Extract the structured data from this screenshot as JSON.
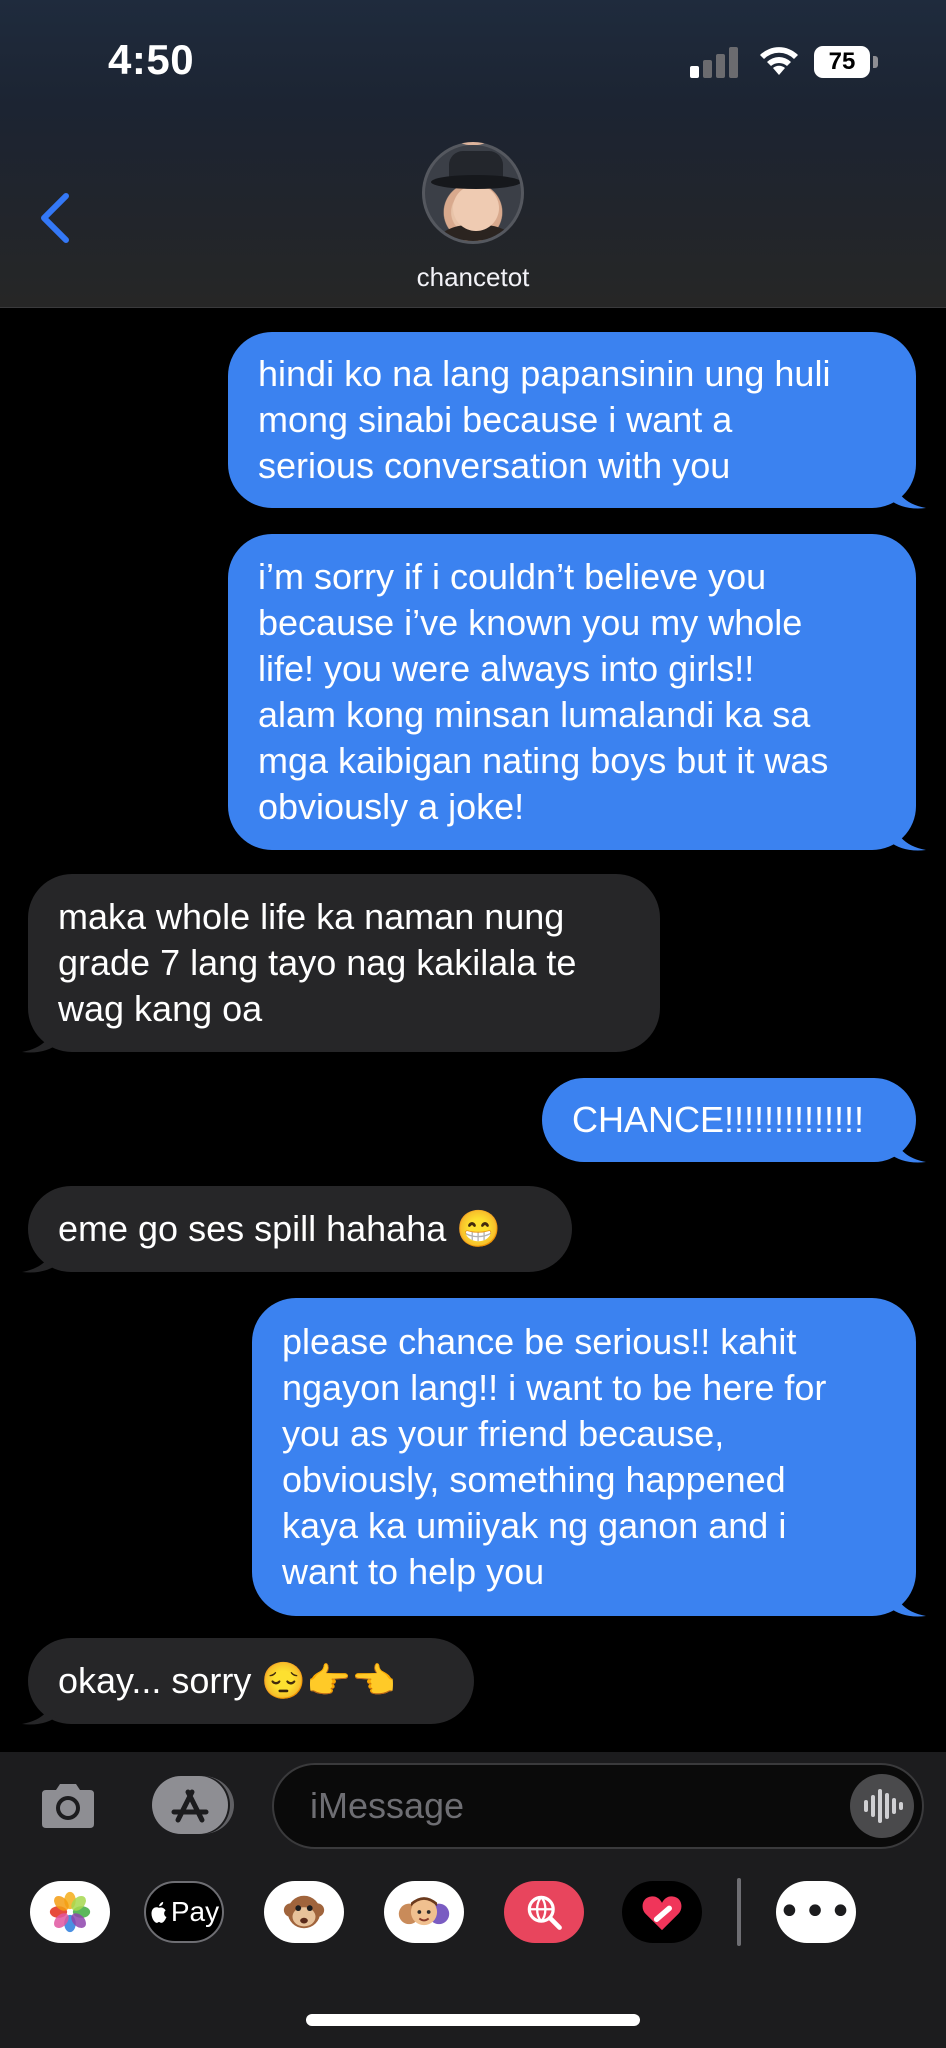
{
  "status_bar": {
    "time": "4:50",
    "battery": "75"
  },
  "contact": {
    "name": "chancetot"
  },
  "messages": [
    {
      "dir": "sent",
      "text": "hindi ko na lang papansinin ung huli\nmong sinabi because i want a\nserious conversation with you"
    },
    {
      "dir": "sent",
      "text": "i’m sorry if i couldn’t believe you\nbecause i’ve known you my whole\nlife! you were always into girls!!\nalam kong minsan lumalandi ka sa\nmga kaibigan nating boys but it was\nobviously a joke!"
    },
    {
      "dir": "received",
      "text": "maka whole life ka naman nung\ngrade 7 lang tayo nag kakilala te\nwag kang oa"
    },
    {
      "dir": "sent",
      "text": "CHANCE!!!!!!!!!!!!!!"
    },
    {
      "dir": "received",
      "text": "eme go ses spill hahaha 😁"
    },
    {
      "dir": "sent",
      "text": "please chance be serious!! kahit\nngayon lang!! i want to be here for\nyou as your friend because,\nobviously, something happened\nkaya ka umiiyak ng ganon and i\nwant to help you"
    },
    {
      "dir": "received",
      "text": "okay... sorry 😔👉👈"
    }
  ],
  "composer": {
    "placeholder": "iMessage"
  },
  "app_drawer": {
    "items": [
      "photos",
      "apple-pay",
      "memoji-stickers",
      "memoji",
      "image-search",
      "digital-touch",
      "more"
    ],
    "apple_pay_label": "Pay",
    "more_label": "•••"
  },
  "colors": {
    "sent_bubble": "#3b82f0",
    "received_bubble": "#262628",
    "accent": "#3478f6"
  }
}
